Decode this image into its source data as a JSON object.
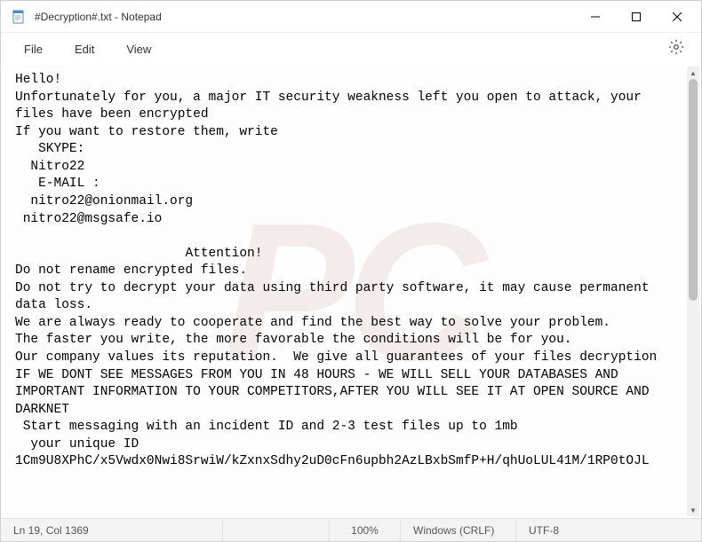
{
  "titlebar": {
    "title": "#Decryption#.txt - Notepad"
  },
  "menubar": {
    "items": [
      {
        "label": "File"
      },
      {
        "label": "Edit"
      },
      {
        "label": "View"
      }
    ]
  },
  "document": {
    "text": "Hello!\nUnfortunately for you, a major IT security weakness left you open to attack, your files have been encrypted\nIf you want to restore them, write\n   SKYPE:\n  Nitro22\n   E-MAIL :\n  nitro22@onionmail.org\n nitro22@msgsafe.io\n\n                      Attention!\nDo not rename encrypted files.\nDo not try to decrypt your data using third party software, it may cause permanent data loss.\nWe are always ready to cooperate and find the best way to solve your problem.\nThe faster you write, the more favorable the conditions will be for you.\nOur company values its reputation.  We give all guarantees of your files decryption\nIF WE DONT SEE MESSAGES FROM YOU IN 48 HOURS - WE WILL SELL YOUR DATABASES AND IMPORTANT INFORMATION TO YOUR COMPETITORS,AFTER YOU WILL SEE IT AT OPEN SOURCE AND DARKNET\n Start messaging with an incident ID and 2-3 test files up to 1mb\n  your unique ID\n1Cm9U8XPhC/x5Vwdx0Nwi8SrwiW/kZxnxSdhy2uD0cFn6upbh2AzLBxbSmfP+H/qhUoLUL41M/1RP0tOJL"
  },
  "statusbar": {
    "position": "Ln 19, Col 1369",
    "zoom": "100%",
    "eol": "Windows (CRLF)",
    "encoding": "UTF-8"
  },
  "watermark": {
    "text": "PC"
  }
}
